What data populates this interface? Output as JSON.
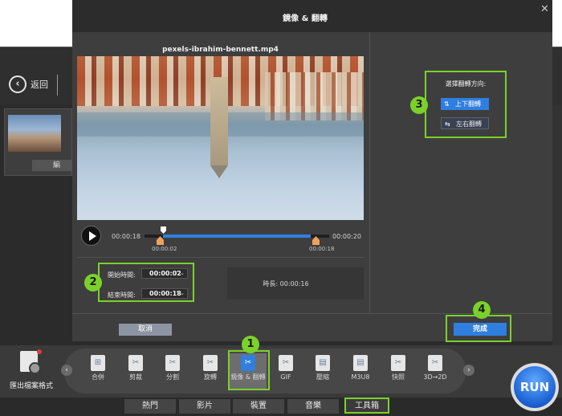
{
  "background_app": {
    "back_label": "返回",
    "file_edit_label": "編",
    "export_label": "匯出檔案格式",
    "run_label": "RUN"
  },
  "modal": {
    "title": "鏡像 & 翻轉",
    "close_icon": "close-icon",
    "video_name": "pexels-ibrahim-bennett.mp4",
    "player": {
      "current_time": "00:00:18",
      "total_time": "00:00:20",
      "trim_start_marker": "00:00:02",
      "trim_end_marker": "00:00:18",
      "trim_start_fraction": 0.1,
      "trim_end_fraction": 0.9
    },
    "time_inputs": {
      "start_label": "開始時間:",
      "start_value": "00:00:02",
      "end_label": "結束時間:",
      "end_value": "00:00:18"
    },
    "duration": "時長: 00:00:16",
    "flip": {
      "title": "選擇翻轉方向:",
      "vertical_label": "上下翻轉",
      "horizontal_label": "左右翻轉"
    },
    "cancel_label": "取消",
    "done_label": "完成"
  },
  "toolbox": {
    "tools": [
      {
        "label": "合併",
        "icon": "merge-icon"
      },
      {
        "label": "剪裁",
        "icon": "crop-icon"
      },
      {
        "label": "分割",
        "icon": "split-icon"
      },
      {
        "label": "旋轉",
        "icon": "rotate-icon"
      },
      {
        "label": "鏡像 & 翻轉",
        "icon": "mirror-flip-icon",
        "active": true
      },
      {
        "label": "GIF",
        "icon": "gif-icon"
      },
      {
        "label": "壓縮",
        "icon": "compress-icon"
      },
      {
        "label": "M3U8",
        "icon": "m3u8-icon"
      },
      {
        "label": "快照",
        "icon": "snapshot-icon"
      },
      {
        "label": "3D→2D",
        "icon": "3d-to-2d-icon"
      }
    ]
  },
  "tabs": [
    "熱門",
    "影片",
    "裝置",
    "音樂",
    "工具箱"
  ],
  "callouts": [
    "1",
    "2",
    "3",
    "4"
  ],
  "colors": {
    "accent": "#2f7fe0",
    "highlight": "#7bd12a",
    "trim_handle": "#f0a15d"
  }
}
